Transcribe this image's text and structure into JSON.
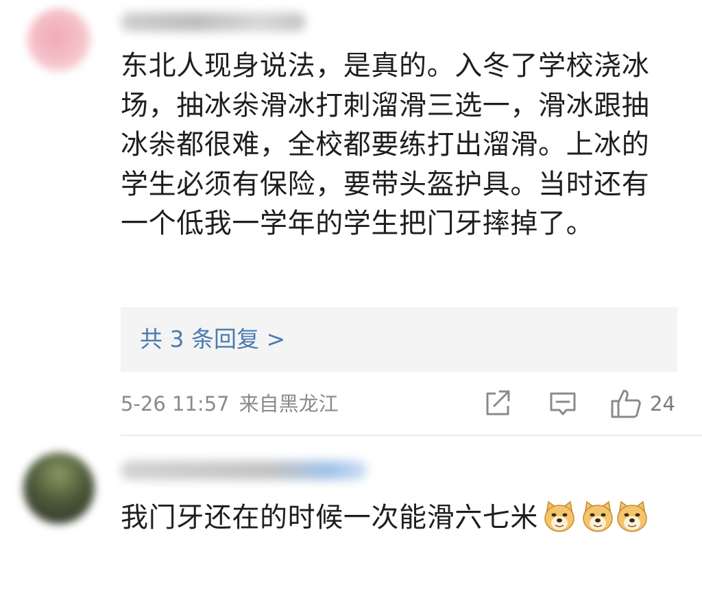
{
  "comment": {
    "text": "东北人现身说法，是真的。入冬了学校浇冰场，抽冰尜滑冰打刺溜滑三选一，滑冰跟抽冰尜都很难，全校都要练打出溜滑。上冰的学生必须有保险，要带头盔护具。当时还有一个低我一学年的学生把门牙摔掉了。",
    "replies_link": "共 3 条回复 >",
    "timestamp": "5-26 11:57",
    "location": "来自黑龙江",
    "likes": "24"
  },
  "reply": {
    "text": "我门牙还在的时候一次能滑六七米",
    "emoji": [
      "doge-emoji",
      "doge-emoji",
      "doge-emoji"
    ]
  },
  "icons": [
    "share-icon",
    "comment-icon",
    "like-icon"
  ],
  "colors": {
    "link": "#4a7bb0",
    "meta": "#8a8a8a",
    "reply_bg": "#f4f4f5"
  }
}
